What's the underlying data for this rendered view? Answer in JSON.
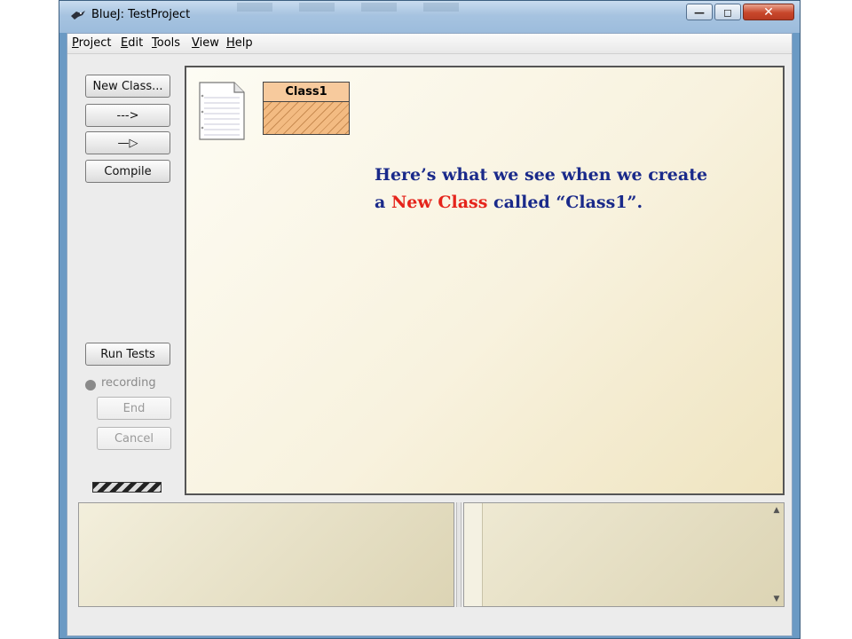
{
  "window": {
    "title": "BlueJ: TestProject"
  },
  "title_controls": {
    "minimize_glyph": "—",
    "maximize_glyph": "◻",
    "close_glyph": "✕"
  },
  "menubar": {
    "items": [
      {
        "label": "Project",
        "mnemonic": "P",
        "rest": "roject"
      },
      {
        "label": "Edit",
        "mnemonic": "E",
        "rest": "dit"
      },
      {
        "label": "Tools",
        "mnemonic": "T",
        "rest": "ools"
      },
      {
        "label": "View",
        "mnemonic": "V",
        "rest": "iew"
      },
      {
        "label": "Help",
        "mnemonic": "H",
        "rest": "elp"
      }
    ]
  },
  "sidebar": {
    "new_class_label": "New Class...",
    "uses_arrow_label": "--->",
    "inherits_arrow_label": "—▷",
    "compile_label": "Compile",
    "run_tests_label": "Run Tests",
    "recording_label": "recording",
    "end_label": "End",
    "cancel_label": "Cancel"
  },
  "canvas": {
    "class_name": "Class1",
    "annotation_line1": "Here’s what we see when we create",
    "annotation_prefix": "a ",
    "annotation_highlight": "New Class",
    "annotation_suffix": " called “Class1”."
  },
  "colors": {
    "annotation": "#1a2a8a",
    "highlight": "#e5241b",
    "class_fill": "#f6c189"
  }
}
